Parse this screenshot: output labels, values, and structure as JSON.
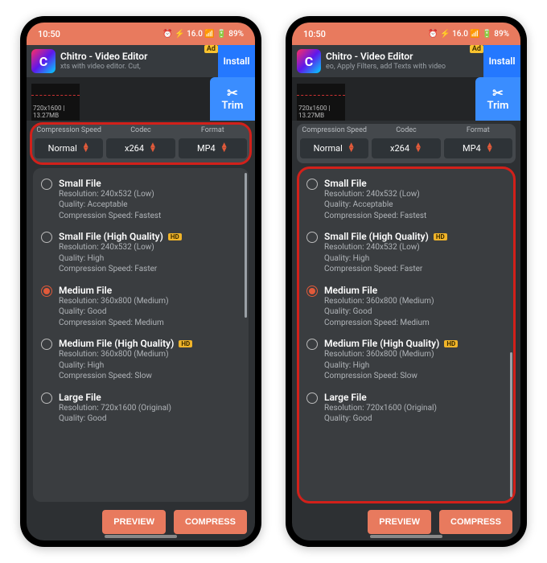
{
  "status": {
    "time": "10:50",
    "icons": "⏰ ⚡ 16.0 📶 🔋 89%"
  },
  "ad": {
    "title": "Chitro - Video Editor",
    "subtitle_left": "xts with video editor.            Cut,",
    "subtitle_right": "eo, Apply Filters, add Texts with video",
    "badge": "Ad",
    "install": "Install"
  },
  "thumb": {
    "meta": "720x1600 | 13.27MB"
  },
  "trim": {
    "label": "Trim"
  },
  "settings": {
    "speed_label": "Compression Speed",
    "codec_label": "Codec",
    "format_label": "Format",
    "speed_value": "Normal",
    "codec_value": "x264",
    "format_value": "MP4"
  },
  "options": [
    {
      "title": "Small File",
      "resolution": "Resolution: 240x532 (Low)",
      "quality": "Quality: Acceptable",
      "speed": "Compression Speed: Fastest",
      "hd": false,
      "selected": false
    },
    {
      "title": "Small File (High Quality)",
      "resolution": "Resolution: 240x532 (Low)",
      "quality": "Quality: High",
      "speed": "Compression Speed: Faster",
      "hd": true,
      "selected": false
    },
    {
      "title": "Medium File",
      "resolution": "Resolution: 360x800 (Medium)",
      "quality": "Quality: Good",
      "speed": "Compression Speed: Medium",
      "hd": false,
      "selected": true
    },
    {
      "title": "Medium File (High Quality)",
      "resolution": "Resolution: 360x800 (Medium)",
      "quality": "Quality: High",
      "speed": "Compression Speed: Slow",
      "hd": true,
      "selected": false
    },
    {
      "title": "Large File",
      "resolution": "Resolution: 720x1600 (Original)",
      "quality": "Quality: Good",
      "speed": "",
      "hd": false,
      "selected": false
    }
  ],
  "buttons": {
    "preview": "PREVIEW",
    "compress": "COMPRESS"
  },
  "colors": {
    "accent": "#e87a5e",
    "blue": "#3a8dff",
    "red": "#d2201a",
    "yellow": "#f0b429"
  }
}
